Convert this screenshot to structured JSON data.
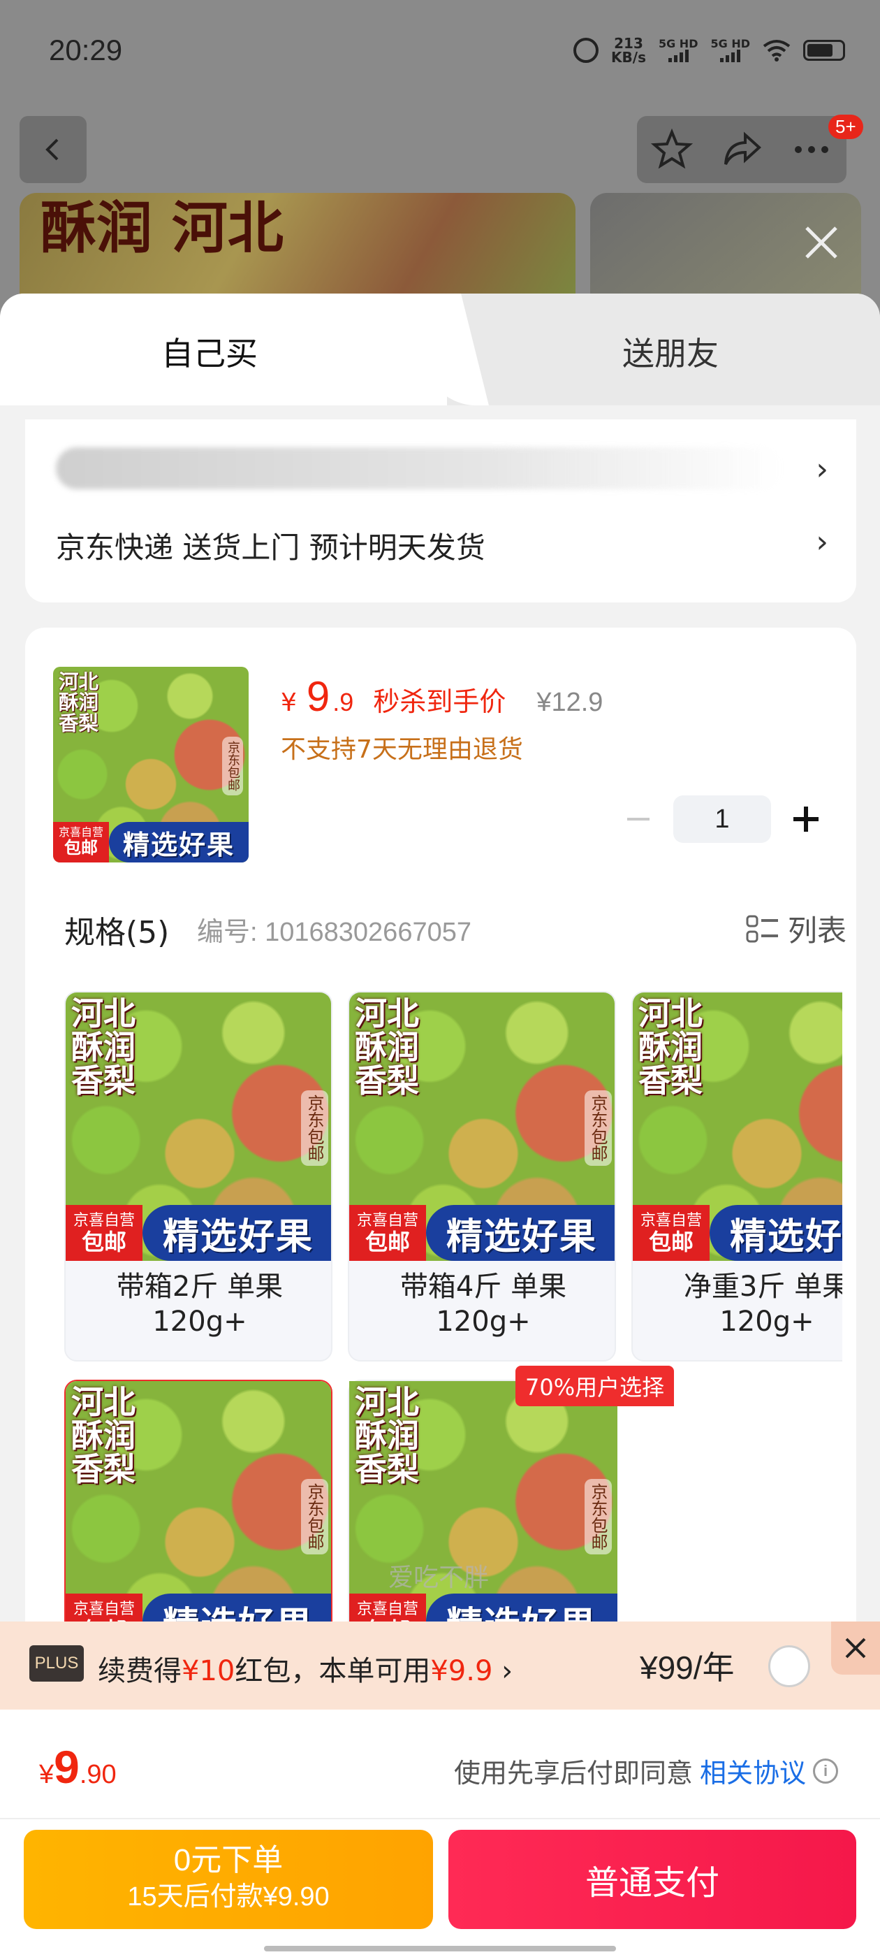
{
  "status": {
    "time": "20:29",
    "speed": "213",
    "speed_unit": "KB/s",
    "sig1": "5G HD",
    "sig2": "5G HD"
  },
  "bg": {
    "badge": "5+",
    "img_title": "酥润 河北"
  },
  "tabs": {
    "self": "自己买",
    "friend": "送朋友"
  },
  "address": {
    "delivery": "京东快递 送货上门 预计明天发货",
    "chevron": "›"
  },
  "product": {
    "price_currency": "¥",
    "price_int": "9",
    "price_dec": ".9",
    "price_tag": "秒杀到手价",
    "price_original": "¥12.9",
    "no_return": "不支持7天无理由退货",
    "quantity": "1"
  },
  "spec": {
    "title": "规格(5)",
    "code": "编号: 10168302667057",
    "list_label": "列表"
  },
  "image_text": {
    "title_a": "酥润",
    "title_b": "香梨",
    "title_c": "河北",
    "side": "京东包邮",
    "red_top": "京喜自营",
    "red_bottom": "包邮",
    "blue": "精选好果"
  },
  "tiles": [
    {
      "line1": "带箱2斤 单果",
      "line2": "120g+"
    },
    {
      "line1": "带箱4斤 单果",
      "line2": "120g+"
    },
    {
      "line1": "净重3斤 单果",
      "line2": "120g+"
    },
    {
      "line1": "",
      "line2": ""
    },
    {
      "line1": "",
      "line2": ""
    }
  ],
  "tile_badge": "70%用户选择",
  "plus": {
    "tag": "PLUS",
    "text_a": "续费得",
    "text_red1": "¥10",
    "text_b": "红包，本单可用",
    "text_red2": "¥9.9",
    "text_chev": " ›",
    "price": "¥99/年"
  },
  "pay": {
    "total_cur": "¥",
    "total_int": "9",
    "total_dec": ".90",
    "agree_text": "使用先享后付即同意",
    "agree_link": "相关协议",
    "info": "i",
    "later_l1": "0元下单",
    "later_l2": "15天后付款¥9.90",
    "normal": "普通支付"
  },
  "watermark": "爱吃不胖",
  "colors": {
    "accent_red": "#f0260f",
    "pay_red": "#ff2a55",
    "later_orange": "#ffb400",
    "link_blue": "#1a6ee6"
  }
}
